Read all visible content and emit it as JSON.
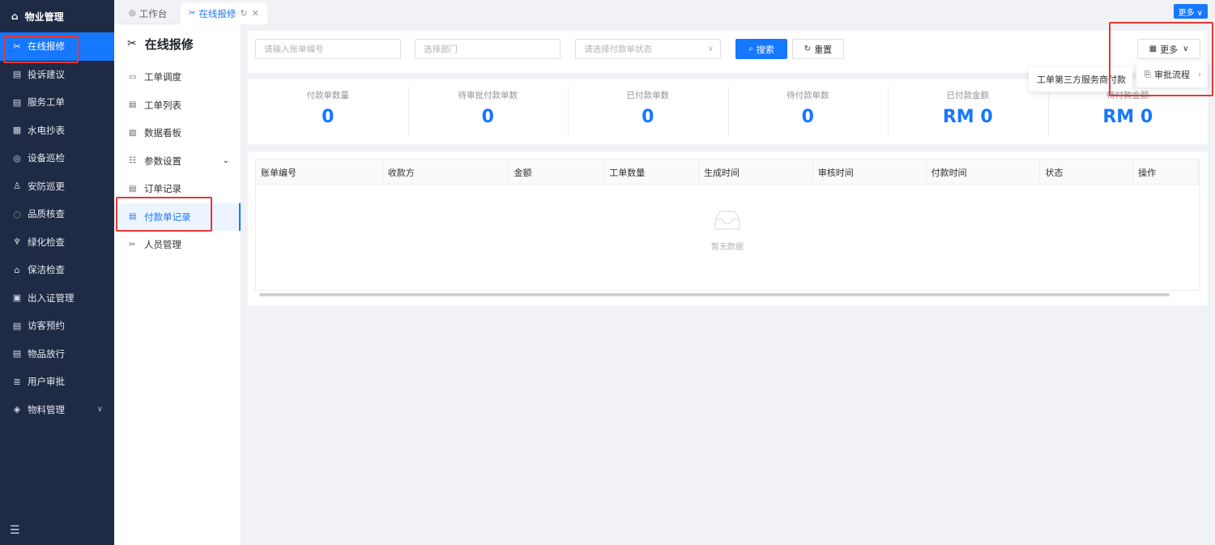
{
  "sidebar": {
    "brand": "物业管理",
    "items": [
      {
        "label": "在线报修",
        "icon": "wrench-icon",
        "glyph": "✂",
        "active": true
      },
      {
        "label": "投诉建议",
        "icon": "message-icon",
        "glyph": "▤"
      },
      {
        "label": "服务工单",
        "icon": "ticket-icon",
        "glyph": "▤"
      },
      {
        "label": "水电抄表",
        "icon": "meter-icon",
        "glyph": "▦"
      },
      {
        "label": "设备巡检",
        "icon": "device-icon",
        "glyph": "◎"
      },
      {
        "label": "安防巡更",
        "icon": "guard-icon",
        "glyph": "♙"
      },
      {
        "label": "品质核查",
        "icon": "shield-icon",
        "glyph": "◌"
      },
      {
        "label": "绿化检查",
        "icon": "plant-icon",
        "glyph": "♆"
      },
      {
        "label": "保洁检查",
        "icon": "clean-icon",
        "glyph": "⌂"
      },
      {
        "label": "出入证管理",
        "icon": "pass-icon",
        "glyph": "▣"
      },
      {
        "label": "访客预约",
        "icon": "visitor-icon",
        "glyph": "▤"
      },
      {
        "label": "物品放行",
        "icon": "goods-icon",
        "glyph": "▤"
      },
      {
        "label": "用户审批",
        "icon": "approve-icon",
        "glyph": "≣"
      },
      {
        "label": "物料管理",
        "icon": "material-icon",
        "glyph": "◈",
        "expandable": true
      }
    ]
  },
  "tabs": [
    {
      "label": "工作台",
      "icon": "dashboard-icon"
    },
    {
      "label": "在线报修",
      "icon": "wrench-icon",
      "active": true
    }
  ],
  "top_more": "更多 ∨",
  "subnav": {
    "title": "在线报修",
    "items": [
      {
        "label": "工单调度",
        "icon": "dispatch-icon",
        "glyph": "▭"
      },
      {
        "label": "工单列表",
        "icon": "list-icon",
        "glyph": "▤"
      },
      {
        "label": "数据看板",
        "icon": "board-icon",
        "glyph": "▨"
      },
      {
        "label": "参数设置",
        "icon": "settings-icon",
        "glyph": "☷",
        "expandable": true
      },
      {
        "label": "订单记录",
        "icon": "order-icon",
        "glyph": "▤"
      },
      {
        "label": "付款单记录",
        "icon": "payment-icon",
        "glyph": "▤",
        "active": true
      },
      {
        "label": "人员管理",
        "icon": "staff-icon",
        "glyph": "✂"
      }
    ]
  },
  "filters": {
    "bill_no_placeholder": "请输入账单编号",
    "dept_placeholder": "选择部门",
    "status_placeholder": "请选择付款单状态",
    "search_label": "搜索",
    "reset_label": "重置",
    "more_label": "更多"
  },
  "stats": [
    {
      "label": "付款单数量",
      "value": "0"
    },
    {
      "label": "待审批付款单数",
      "value": "0"
    },
    {
      "label": "已付款单数",
      "value": "0"
    },
    {
      "label": "待付款单数",
      "value": "0"
    },
    {
      "label": "已付款金额",
      "value": "RM 0"
    },
    {
      "label": "待付款金额",
      "value": "RM 0"
    }
  ],
  "table": {
    "columns": [
      "账单编号",
      "收款方",
      "金额",
      "工单数量",
      "生成时间",
      "审核时间",
      "付款时间",
      "状态",
      "操作"
    ],
    "empty_text": "暂无数据"
  },
  "dropdown": {
    "item": "审批流程",
    "submenu_item": "工单第三方服务商付款"
  },
  "colors": {
    "primary": "#1677ff",
    "sidebar_bg": "#1f2a44",
    "annotation": "#e53935"
  }
}
